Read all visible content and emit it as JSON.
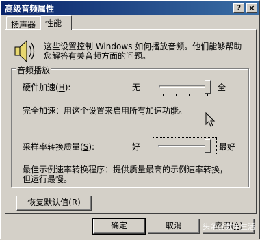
{
  "window": {
    "title": "高级音频属性",
    "help_button": "?",
    "close_button": "×"
  },
  "tabs": [
    {
      "label": "扬声器"
    },
    {
      "label": "性能"
    }
  ],
  "intro_text": {
    "line1": "这些设置控制 Windows 如何播放音频。他们能够帮助",
    "line2": "您解答有关音频方面的问题。"
  },
  "group": {
    "label": "音频播放",
    "hardware_accel": {
      "label": "硬件加速(",
      "mnemonic": "H",
      "label_end": "):",
      "min_label": "无",
      "max_label": "全",
      "value_fraction": 1.0,
      "description": "完全加速：用这个设置来启用所有加速功能。"
    },
    "sample_rate": {
      "label": "采样率转换质量(",
      "mnemonic": "S",
      "label_end": "):",
      "min_label": "好",
      "max_label": "最好",
      "value_fraction": 1.0,
      "description_line1": "最佳示例速率转换程序：提供质量最高的示例速率转换，",
      "description_line2": "但运行最慢。"
    }
  },
  "restore_button": {
    "label": "恢复默认值(",
    "mnemonic": "R",
    "label_end": ")"
  },
  "footer": {
    "ok": "确定",
    "cancel": "取消",
    "apply": "应用(",
    "apply_mnemonic": "A",
    "apply_end": ")"
  },
  "watermark": "头条@数字生活"
}
